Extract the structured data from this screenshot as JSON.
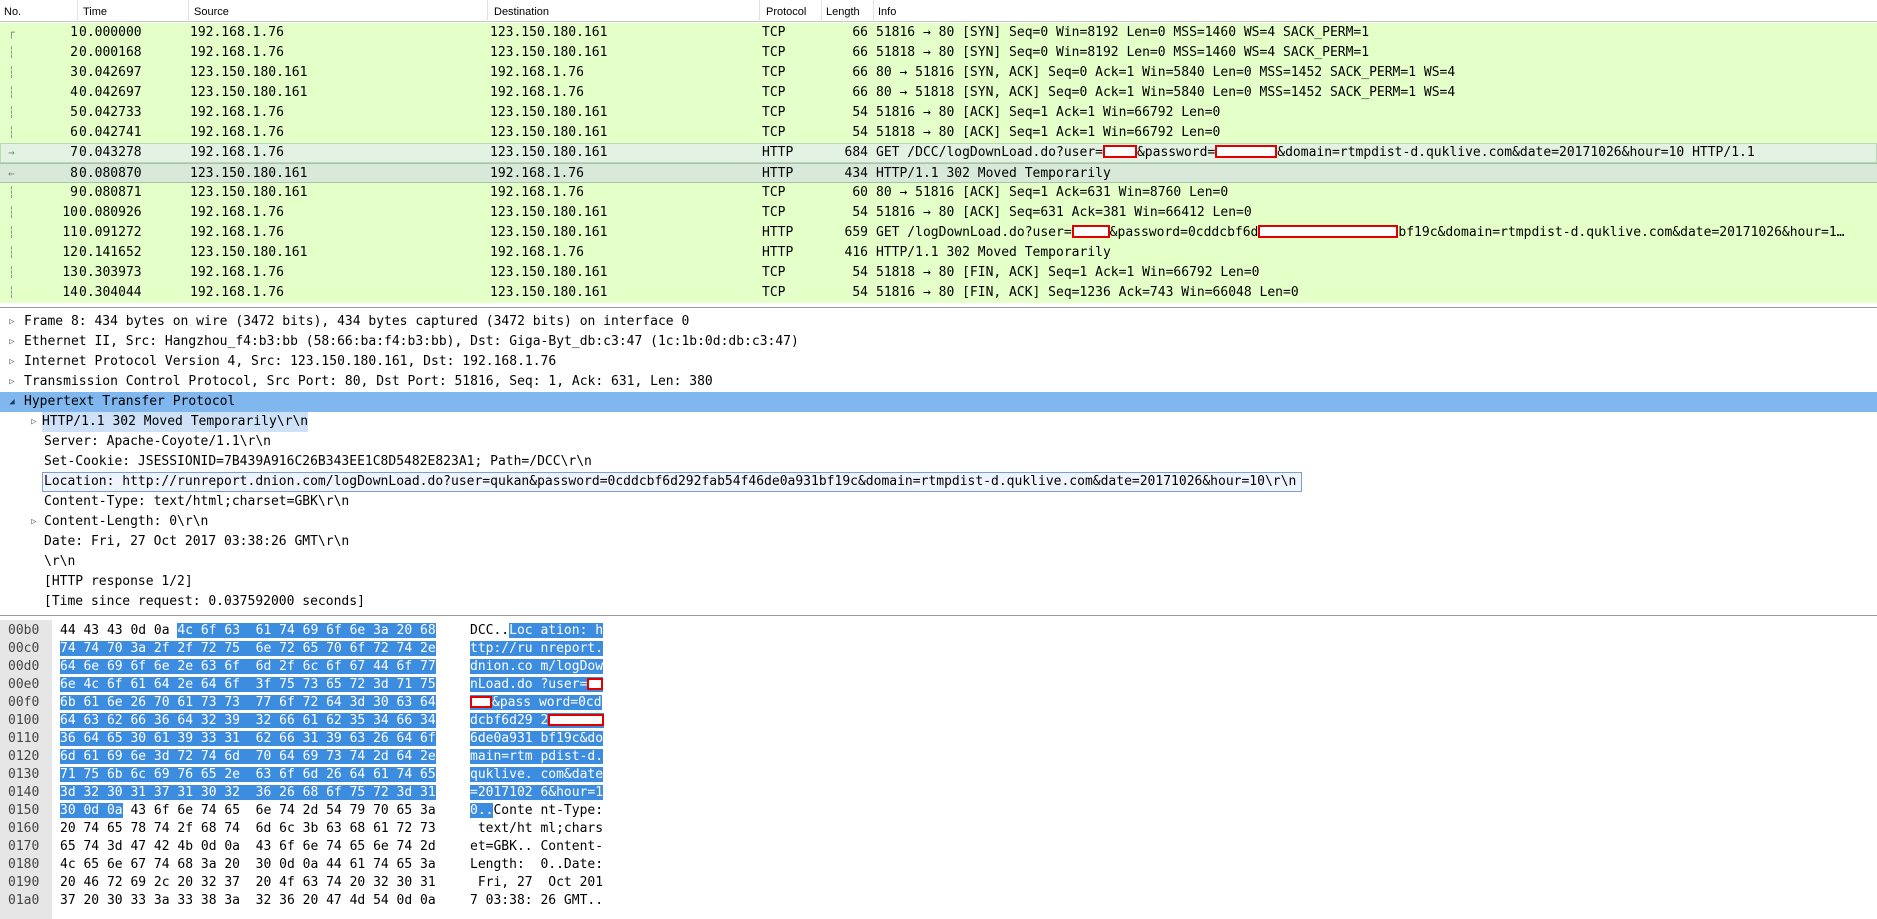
{
  "packet_list": {
    "columns": {
      "no": "No.",
      "time": "Time",
      "source": "Source",
      "destination": "Destination",
      "protocol": "Protocol",
      "length": "Length",
      "info": "Info"
    },
    "rows": [
      {
        "no": "1",
        "time": "0.000000",
        "src": "192.168.1.76",
        "dst": "123.150.180.161",
        "proto": "TCP",
        "len": "66",
        "info": "51816 → 80 [SYN] Seq=0 Win=8192 Len=0 MSS=1460 WS=4 SACK_PERM=1"
      },
      {
        "no": "2",
        "time": "0.000168",
        "src": "192.168.1.76",
        "dst": "123.150.180.161",
        "proto": "TCP",
        "len": "66",
        "info": "51818 → 80 [SYN] Seq=0 Win=8192 Len=0 MSS=1460 WS=4 SACK_PERM=1"
      },
      {
        "no": "3",
        "time": "0.042697",
        "src": "123.150.180.161",
        "dst": "192.168.1.76",
        "proto": "TCP",
        "len": "66",
        "info": "80 → 51816 [SYN, ACK] Seq=0 Ack=1 Win=5840 Len=0 MSS=1452 SACK_PERM=1 WS=4"
      },
      {
        "no": "4",
        "time": "0.042697",
        "src": "123.150.180.161",
        "dst": "192.168.1.76",
        "proto": "TCP",
        "len": "66",
        "info": "80 → 51818 [SYN, ACK] Seq=0 Ack=1 Win=5840 Len=0 MSS=1452 SACK_PERM=1 WS=4"
      },
      {
        "no": "5",
        "time": "0.042733",
        "src": "192.168.1.76",
        "dst": "123.150.180.161",
        "proto": "TCP",
        "len": "54",
        "info": "51816 → 80 [ACK] Seq=1 Ack=1 Win=66792 Len=0"
      },
      {
        "no": "6",
        "time": "0.042741",
        "src": "192.168.1.76",
        "dst": "123.150.180.161",
        "proto": "TCP",
        "len": "54",
        "info": "51818 → 80 [ACK] Seq=1 Ack=1 Win=66792 Len=0"
      },
      {
        "no": "7",
        "time": "0.043278",
        "src": "192.168.1.76",
        "dst": "123.150.180.161",
        "proto": "HTTP",
        "len": "684",
        "info_a": "GET /DCC/logDownLoad.do?user=",
        "info_b": "&password=",
        "info_c": "&domain=rtmpdist-d.quklive.com&date=20171026&hour=10 HTTP/1.1"
      },
      {
        "no": "8",
        "time": "0.080870",
        "src": "123.150.180.161",
        "dst": "192.168.1.76",
        "proto": "HTTP",
        "len": "434",
        "info": "HTTP/1.1 302 Moved Temporarily"
      },
      {
        "no": "9",
        "time": "0.080871",
        "src": "123.150.180.161",
        "dst": "192.168.1.76",
        "proto": "TCP",
        "len": "60",
        "info": "80 → 51816 [ACK] Seq=1 Ack=631 Win=8760 Len=0"
      },
      {
        "no": "10",
        "time": "0.080926",
        "src": "192.168.1.76",
        "dst": "123.150.180.161",
        "proto": "TCP",
        "len": "54",
        "info": "51816 → 80 [ACK] Seq=631 Ack=381 Win=66412 Len=0"
      },
      {
        "no": "11",
        "time": "0.091272",
        "src": "192.168.1.76",
        "dst": "123.150.180.161",
        "proto": "HTTP",
        "len": "659",
        "info_a": "GET /logDownLoad.do?user=",
        "info_b": "&password=0cddcbf6d",
        "info_c": "bf19c&domain=rtmpdist-d.quklive.com&date=20171026&hour=1…"
      },
      {
        "no": "12",
        "time": "0.141652",
        "src": "123.150.180.161",
        "dst": "192.168.1.76",
        "proto": "HTTP",
        "len": "416",
        "info": "HTTP/1.1 302 Moved Temporarily"
      },
      {
        "no": "13",
        "time": "0.303973",
        "src": "192.168.1.76",
        "dst": "123.150.180.161",
        "proto": "TCP",
        "len": "54",
        "info": "51818 → 80 [FIN, ACK] Seq=1 Ack=1 Win=66792 Len=0"
      },
      {
        "no": "14",
        "time": "0.304044",
        "src": "192.168.1.76",
        "dst": "123.150.180.161",
        "proto": "TCP",
        "len": "54",
        "info": "51816 → 80 [FIN, ACK] Seq=1236 Ack=743 Win=66048 Len=0"
      }
    ]
  },
  "details": {
    "frame": "Frame 8: 434 bytes on wire (3472 bits), 434 bytes captured (3472 bits) on interface 0",
    "ethernet": "Ethernet II, Src: Hangzhou_f4:b3:bb (58:66:ba:f4:b3:bb), Dst: Giga-Byt_db:c3:47 (1c:1b:0d:db:c3:47)",
    "ip": "Internet Protocol Version 4, Src: 123.150.180.161, Dst: 192.168.1.76",
    "tcp": "Transmission Control Protocol, Src Port: 80, Dst Port: 51816, Seq: 1, Ack: 631, Len: 380",
    "http": "Hypertext Transfer Protocol",
    "status_line": "HTTP/1.1 302 Moved Temporarily\\r\\n",
    "server": "Server: Apache-Coyote/1.1\\r\\n",
    "set_cookie": "Set-Cookie: JSESSIONID=7B439A916C26B343EE1C8D5482E823A1; Path=/DCC\\r\\n",
    "location": "Location: http://runreport.dnion.com/logDownLoad.do?user=qukan&password=0cddcbf6d292fab54f46de0a931bf19c&domain=rtmpdist-d.quklive.com&date=20171026&hour=10\\r\\n",
    "content_type": "Content-Type: text/html;charset=GBK\\r\\n",
    "content_length": "Content-Length: 0\\r\\n",
    "date": "Date: Fri, 27 Oct 2017 03:38:26 GMT\\r\\n",
    "crlf": "\\r\\n",
    "response_num": "[HTTP response 1/2]",
    "time_since": "[Time since request: 0.037592000 seconds]"
  },
  "bytes": {
    "rows": [
      {
        "off": "00b0",
        "hex_pre": "44 43 43 0d 0a ",
        "hex_hl": "4c 6f 63  61 74 69 6f 6e 3a 20 68",
        "hex_post": "",
        "ascii_pre": "DCC..",
        "ascii_hl": "Loc ation: h",
        "ascii_post": ""
      },
      {
        "off": "00c0",
        "hex_pre": "",
        "hex_hl": "74 74 70 3a 2f 2f 72 75  6e 72 65 70 6f 72 74 2e",
        "hex_post": "",
        "ascii_pre": "",
        "ascii_hl": "ttp://ru nreport.",
        "ascii_post": ""
      },
      {
        "off": "00d0",
        "hex_pre": "",
        "hex_hl": "64 6e 69 6f 6e 2e 63 6f  6d 2f 6c 6f 67 44 6f 77",
        "hex_post": "",
        "ascii_pre": "",
        "ascii_hl": "dnion.co m/logDow",
        "ascii_post": ""
      },
      {
        "off": "00e0",
        "hex_pre": "",
        "hex_hl": "6e 4c 6f 61 64 2e 64 6f  3f 75 73 65 72 3d 71 75",
        "hex_post": "",
        "ascii_pre": "",
        "ascii_hl": "nLoad.do ?user=",
        "ascii_post": "",
        "redact_ascii": "end"
      },
      {
        "off": "00f0",
        "hex_pre": "",
        "hex_hl": "6b 61 6e 26 70 61 73 73  77 6f 72 64 3d 30 63 64",
        "hex_post": "",
        "ascii_pre": "",
        "ascii_hl": "&pass word=0cd",
        "ascii_post": "",
        "redact_ascii": "start"
      },
      {
        "off": "0100",
        "hex_pre": "",
        "hex_hl": "64 63 62 66 36 64 32 39  32 66 61 62 35 34 66 34",
        "hex_post": "",
        "ascii_pre": "",
        "ascii_hl": "dcbf6d29 2",
        "ascii_post": "",
        "redact_ascii": "end_wide"
      },
      {
        "off": "0110",
        "hex_pre": "",
        "hex_hl": "36 64 65 30 61 39 33 31  62 66 31 39 63 26 64 6f",
        "hex_post": "",
        "ascii_pre": "",
        "ascii_hl": "6de0a931 bf19c&do",
        "ascii_post": ""
      },
      {
        "off": "0120",
        "hex_pre": "",
        "hex_hl": "6d 61 69 6e 3d 72 74 6d  70 64 69 73 74 2d 64 2e",
        "hex_post": "",
        "ascii_pre": "",
        "ascii_hl": "main=rtm pdist-d.",
        "ascii_post": ""
      },
      {
        "off": "0130",
        "hex_pre": "",
        "hex_hl": "71 75 6b 6c 69 76 65 2e  63 6f 6d 26 64 61 74 65",
        "hex_post": "",
        "ascii_pre": "",
        "ascii_hl": "quklive. com&date",
        "ascii_post": ""
      },
      {
        "off": "0140",
        "hex_pre": "",
        "hex_hl": "3d 32 30 31 37 31 30 32  36 26 68 6f 75 72 3d 31",
        "hex_post": "",
        "ascii_pre": "",
        "ascii_hl": "=2017102 6&hour=1",
        "ascii_post": ""
      },
      {
        "off": "0150",
        "hex_pre": "",
        "hex_hl": "30 0d 0a",
        "hex_post": " 43 6f 6e 74 65  6e 74 2d 54 79 70 65 3a",
        "ascii_pre": "",
        "ascii_hl": "0..",
        "ascii_post": "Conte nt-Type:"
      },
      {
        "off": "0160",
        "hex_pre": "20 74 65 78 74 2f 68 74  6d 6c 3b 63 68 61 72 73",
        "hex_hl": "",
        "hex_post": "",
        "ascii_pre": " text/ht ml;chars",
        "ascii_hl": "",
        "ascii_post": ""
      },
      {
        "off": "0170",
        "hex_pre": "65 74 3d 47 42 4b 0d 0a  43 6f 6e 74 65 6e 74 2d",
        "hex_hl": "",
        "hex_post": "",
        "ascii_pre": "et=GBK.. Content-",
        "ascii_hl": "",
        "ascii_post": ""
      },
      {
        "off": "0180",
        "hex_pre": "4c 65 6e 67 74 68 3a 20  30 0d 0a 44 61 74 65 3a",
        "hex_hl": "",
        "hex_post": "",
        "ascii_pre": "Length:  0..Date:",
        "ascii_hl": "",
        "ascii_post": ""
      },
      {
        "off": "0190",
        "hex_pre": "20 46 72 69 2c 20 32 37  20 4f 63 74 20 32 30 31",
        "hex_hl": "",
        "hex_post": "",
        "ascii_pre": " Fri, 27  Oct 201",
        "ascii_hl": "",
        "ascii_post": ""
      },
      {
        "off": "01a0",
        "hex_pre": "37 20 30 33 3a 33 38 3a  32 36 20 47 4d 54 0d 0a",
        "hex_hl": "",
        "hex_post": "",
        "ascii_pre": "7 03:38: 26 GMT..",
        "ascii_hl": "",
        "ascii_post": ""
      }
    ]
  },
  "colors": {
    "tcp_row": "#e4ffc7",
    "selected_tree": "#80b7ee",
    "bytes_highlight": "#3c8de0",
    "redaction": "#e00000"
  }
}
